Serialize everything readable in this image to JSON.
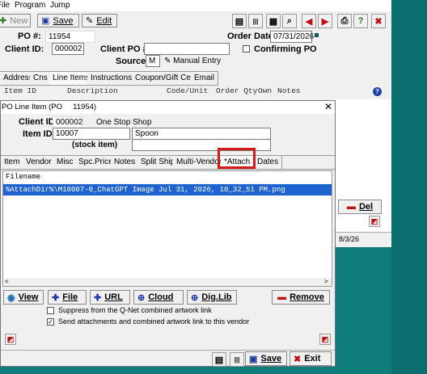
{
  "menu": {
    "file": "File",
    "program": "Program",
    "jump": "Jump"
  },
  "toolbar": {
    "new": "New",
    "save": "Save",
    "edit": "Edit"
  },
  "po": {
    "po_label": "PO #:",
    "po_value": "11954",
    "client_id_label": "Client ID:",
    "client_id_value": "000002",
    "client_po_label": "Client PO #:",
    "client_po_value": "",
    "order_date_label": "Order Date:",
    "order_date_value": "07/31/2026",
    "confirming_label": "Confirming PO",
    "source_label": "Source:",
    "source_value": "M",
    "manual_entry": "Manual Entry"
  },
  "main_tabs": [
    "Address",
    "Cns",
    "Line Items",
    "Instructions",
    "Coupon/Gift Cert.",
    "Email"
  ],
  "line_headers": {
    "item_id": "Item ID",
    "description": "Description",
    "code_unit": "Code/Unit",
    "order_qty": "Order Qty",
    "own": "Own",
    "notes": "Notes"
  },
  "side": {
    "del_label": "Del",
    "date_value": "8/3/26"
  },
  "dialog": {
    "title": "PO Line Item (PO     11954)",
    "client_id_label": "Client ID:",
    "client_id_value": "000002",
    "client_name": "One Stop Shop",
    "item_id_label": "Item ID:",
    "item_id_value": "10007",
    "item_name": "Spoon",
    "stock_item": "(stock item)",
    "tabs": [
      "Item",
      "Vendor",
      "Misc",
      "Spc.Price",
      "Notes",
      "Split Ship",
      "Multi-Vendor",
      "*Attach",
      "Dates"
    ],
    "active_tab": "*Attach",
    "filename_header": "Filename",
    "files": [
      "%AttachDir%\\M10007-0_ChatGPT Image Jul 31, 2026, 10_32_51 PM.png"
    ],
    "buttons": {
      "view": "View",
      "file": "File",
      "url": "URL",
      "cloud": "Cloud",
      "diglib": "Dig.Lib",
      "remove": "Remove",
      "save": "Save",
      "exit": "Exit"
    },
    "suppress_label": "Suppress from the Q-Net combined artwork link",
    "suppress_checked": false,
    "send_label": "Send attachments and combined artwork link to this vendor",
    "send_checked": true
  },
  "colors": {
    "accent_red": "#d11a1a",
    "selection": "#1f63d1",
    "teal": "#0f7c7c"
  }
}
